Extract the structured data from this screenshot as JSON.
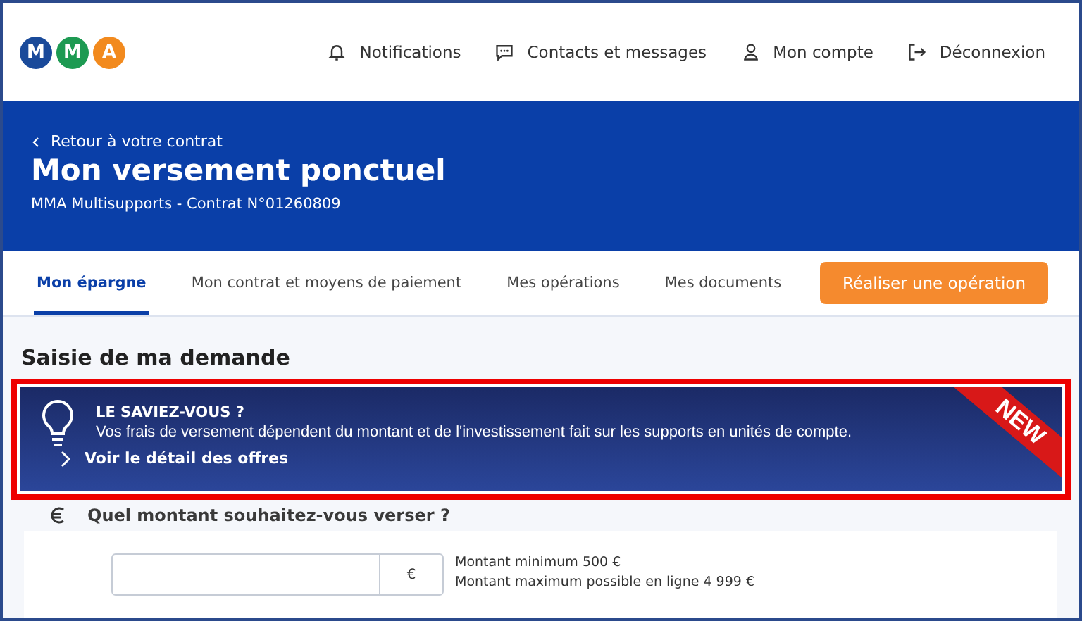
{
  "header": {
    "logo_letters": [
      "M",
      "M",
      "A"
    ],
    "nav": [
      {
        "kind": "bell",
        "label": "Notifications"
      },
      {
        "kind": "chat",
        "label": "Contacts et messages"
      },
      {
        "kind": "user",
        "label": "Mon compte"
      },
      {
        "kind": "logout",
        "label": "Déconnexion"
      }
    ]
  },
  "hero": {
    "back_link": "Retour à votre contrat",
    "title": "Mon versement ponctuel",
    "subtitle": "MMA Multisupports - Contrat N°01260809"
  },
  "tabs": [
    {
      "label": "Mon épargne",
      "selected": true
    },
    {
      "label": "Mon contrat et moyens de paiement",
      "selected": false
    },
    {
      "label": "Mes opérations",
      "selected": false
    },
    {
      "label": "Mes documents",
      "selected": false
    }
  ],
  "action_button": "Réaliser une opération",
  "section_title": "Saisie de ma demande",
  "tip": {
    "title": "LE SAVIEZ-VOUS ?",
    "text": "Vos frais de versement dépendent du montant et de l'investissement fait sur les supports en unités de compte.",
    "link": "Voir le détail des offres",
    "ribbon": "NEW"
  },
  "question": "Quel montant souhaitez-vous verser ?",
  "amount": {
    "unit": "€",
    "hints": [
      "Montant minimum 500 €",
      "Montant maximum possible en ligne 4 999 €"
    ]
  }
}
